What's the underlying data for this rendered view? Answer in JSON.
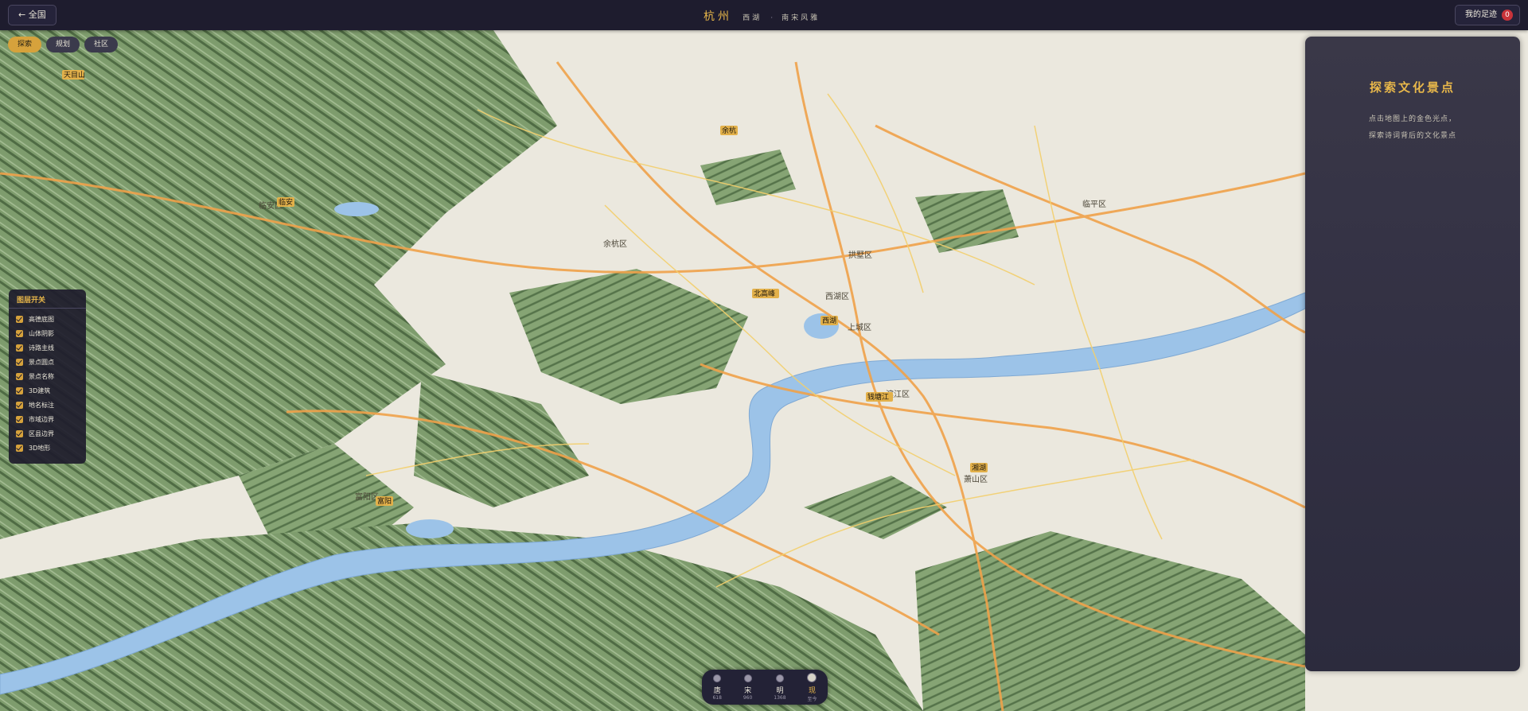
{
  "topbar": {
    "back_label": "← 全国",
    "city": "杭州",
    "sub1": "西湖",
    "sep": "·",
    "sub2": "南宋风雅",
    "footprint_label": "我的足迹",
    "footprint_count": "0"
  },
  "modes": [
    "探索",
    "规划",
    "社区"
  ],
  "layers": {
    "title": "图层开关",
    "items": [
      "高德底图",
      "山体阴影",
      "诗路主线",
      "景点圆点",
      "景点名称",
      "3D建筑",
      "地名标注",
      "市域边界",
      "区县边界",
      "3D地形"
    ]
  },
  "panel": {
    "title": "探索文化景点",
    "line1": "点击地图上的金色光点，",
    "line2": "探索诗词背后的文化景点"
  },
  "timeline": [
    {
      "name": "唐",
      "year": "618"
    },
    {
      "name": "宋",
      "year": "960"
    },
    {
      "name": "明",
      "year": "1368"
    },
    {
      "name": "现",
      "year": "至今",
      "active": true
    }
  ],
  "map": {
    "district_labels": [
      "临安区",
      "余杭区",
      "拱墅区",
      "西湖区",
      "上城区",
      "滨江区",
      "萧山区",
      "临平区",
      "富阳区"
    ],
    "gold_markers": [
      "天目山",
      "余杭",
      "临安",
      "北高峰",
      "西湖",
      "钱塘江",
      "湘湖",
      "富阳"
    ]
  },
  "colors": {
    "accent": "#e9b84a",
    "bar": "#1e1c2e",
    "water": "#9cc3e8",
    "forest": "#6f9260"
  }
}
